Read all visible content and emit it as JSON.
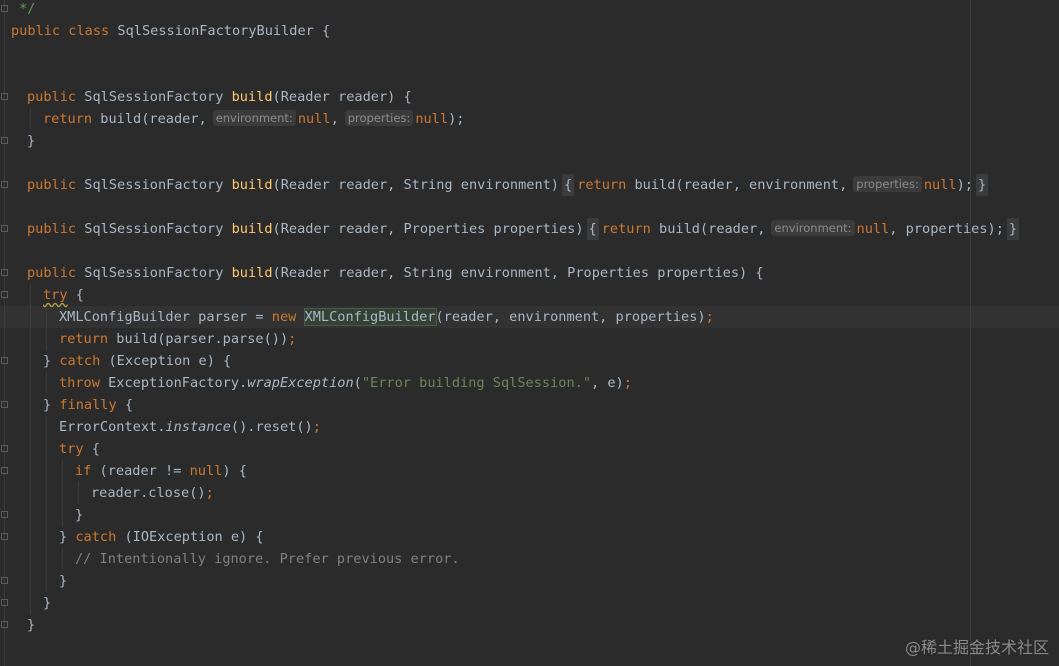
{
  "editor": {
    "language": "java",
    "accent_keyword_color": "#cc7832",
    "accent_method_color": "#ffc66d",
    "accent_string_color": "#6a8759",
    "lines": [
      {
        "id": "l0",
        "text": "*/"
      },
      {
        "id": "l1",
        "text": "public class SqlSessionFactoryBuilder {"
      },
      {
        "id": "l2",
        "text": "public SqlSessionFactory build(Reader reader) {"
      },
      {
        "id": "l3a",
        "text": "return build(reader,"
      },
      {
        "id": "l3_hint1",
        "text": "environment:"
      },
      {
        "id": "l3b",
        "text": "null,"
      },
      {
        "id": "l3_hint2",
        "text": "properties:"
      },
      {
        "id": "l3c",
        "text": "null);"
      },
      {
        "id": "l4",
        "text": "}"
      },
      {
        "id": "l5a",
        "text": "public SqlSessionFactory build(Reader reader, String environment)"
      },
      {
        "id": "l5b",
        "text": "{ return build(reader, environment,"
      },
      {
        "id": "l5_hint",
        "text": "properties:"
      },
      {
        "id": "l5c",
        "text": "null); }"
      },
      {
        "id": "l6a",
        "text": "public SqlSessionFactory build(Reader reader, Properties properties)"
      },
      {
        "id": "l6b",
        "text": "{ return build(reader,"
      },
      {
        "id": "l6_hint",
        "text": "environment:"
      },
      {
        "id": "l6c",
        "text": "null, properties); }"
      },
      {
        "id": "l7",
        "text": "public SqlSessionFactory build(Reader reader, String environment, Properties properties) {"
      },
      {
        "id": "l8",
        "text": "try {"
      },
      {
        "id": "l9",
        "text": "XMLConfigBuilder parser = new XMLConfigBuilder(reader, environment, properties);"
      },
      {
        "id": "l10",
        "text": "return build(parser.parse());"
      },
      {
        "id": "l11",
        "text": "} catch (Exception e) {"
      },
      {
        "id": "l12",
        "text": "throw ExceptionFactory.wrapException(\"Error building SqlSession.\", e);"
      },
      {
        "id": "l13",
        "text": "} finally {"
      },
      {
        "id": "l14",
        "text": "ErrorContext.instance().reset();"
      },
      {
        "id": "l15",
        "text": "try {"
      },
      {
        "id": "l16",
        "text": "if (reader != null) {"
      },
      {
        "id": "l17",
        "text": "reader.close();"
      },
      {
        "id": "l18",
        "text": "}"
      },
      {
        "id": "l19",
        "text": "} catch (IOException e) {"
      },
      {
        "id": "l20",
        "text": "// Intentionally ignore. Prefer previous error."
      },
      {
        "id": "l21",
        "text": "}"
      },
      {
        "id": "l22",
        "text": "}"
      },
      {
        "id": "l23",
        "text": "}"
      }
    ]
  },
  "tokens": {
    "public": "public",
    "class": "class",
    "return": "return",
    "new": "new",
    "try": "try",
    "catch": "catch",
    "finally": "finally",
    "throw": "throw",
    "if": "if",
    "null": "null",
    "build": "build",
    "class_name": "SqlSessionFactoryBuilder",
    "type_factory": "SqlSessionFactory",
    "xml_builder": "XMLConfigBuilder",
    "error_msg": "\"Error building SqlSession.\"",
    "wrap": "wrapException",
    "instance": "instance",
    "comment": "// Intentionally ignore. Prefer previous error."
  },
  "watermark": "@稀土掘金技术社区"
}
